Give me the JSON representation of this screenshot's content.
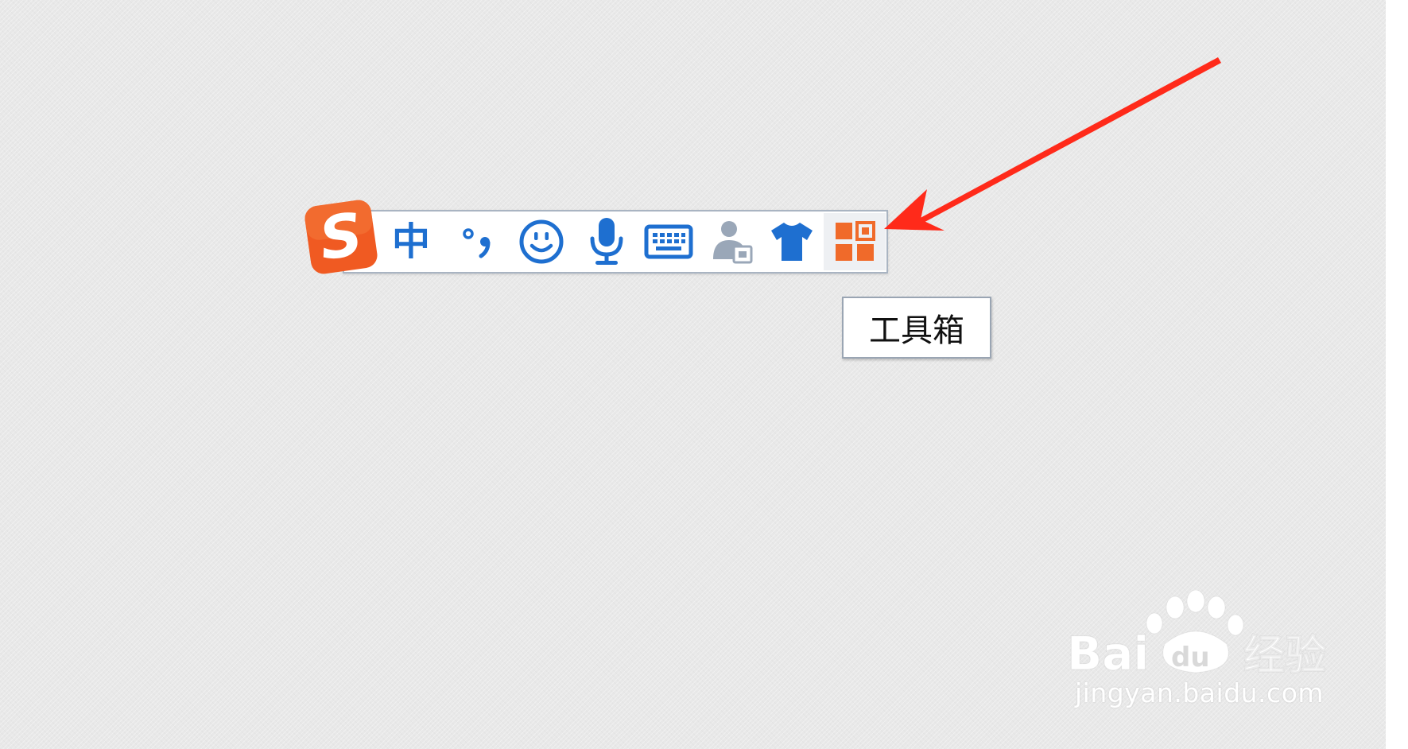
{
  "ime_toolbar": {
    "logo_letter": "S",
    "lang_mode": "中",
    "buttons": [
      {
        "icon": "punctuation-icon"
      },
      {
        "icon": "emoji-icon"
      },
      {
        "icon": "microphone-icon"
      },
      {
        "icon": "keyboard-icon"
      },
      {
        "icon": "user-account-icon"
      },
      {
        "icon": "skin-shirt-icon"
      },
      {
        "icon": "toolbox-grid-icon"
      }
    ],
    "colors": {
      "icon_blue": "#1e6fd0",
      "logo_orange": "#f05a22",
      "toolbox_orange": "#f06a2a",
      "user_icon_gray": "#9aa7b8"
    }
  },
  "tooltip": {
    "text": "工具箱"
  },
  "annotation": {
    "arrow_color": "#ff2a1a"
  },
  "watermark": {
    "brand_text": "Bai",
    "brand_du": "du",
    "brand_cn": "经验",
    "url": "jingyan.baidu.com"
  }
}
